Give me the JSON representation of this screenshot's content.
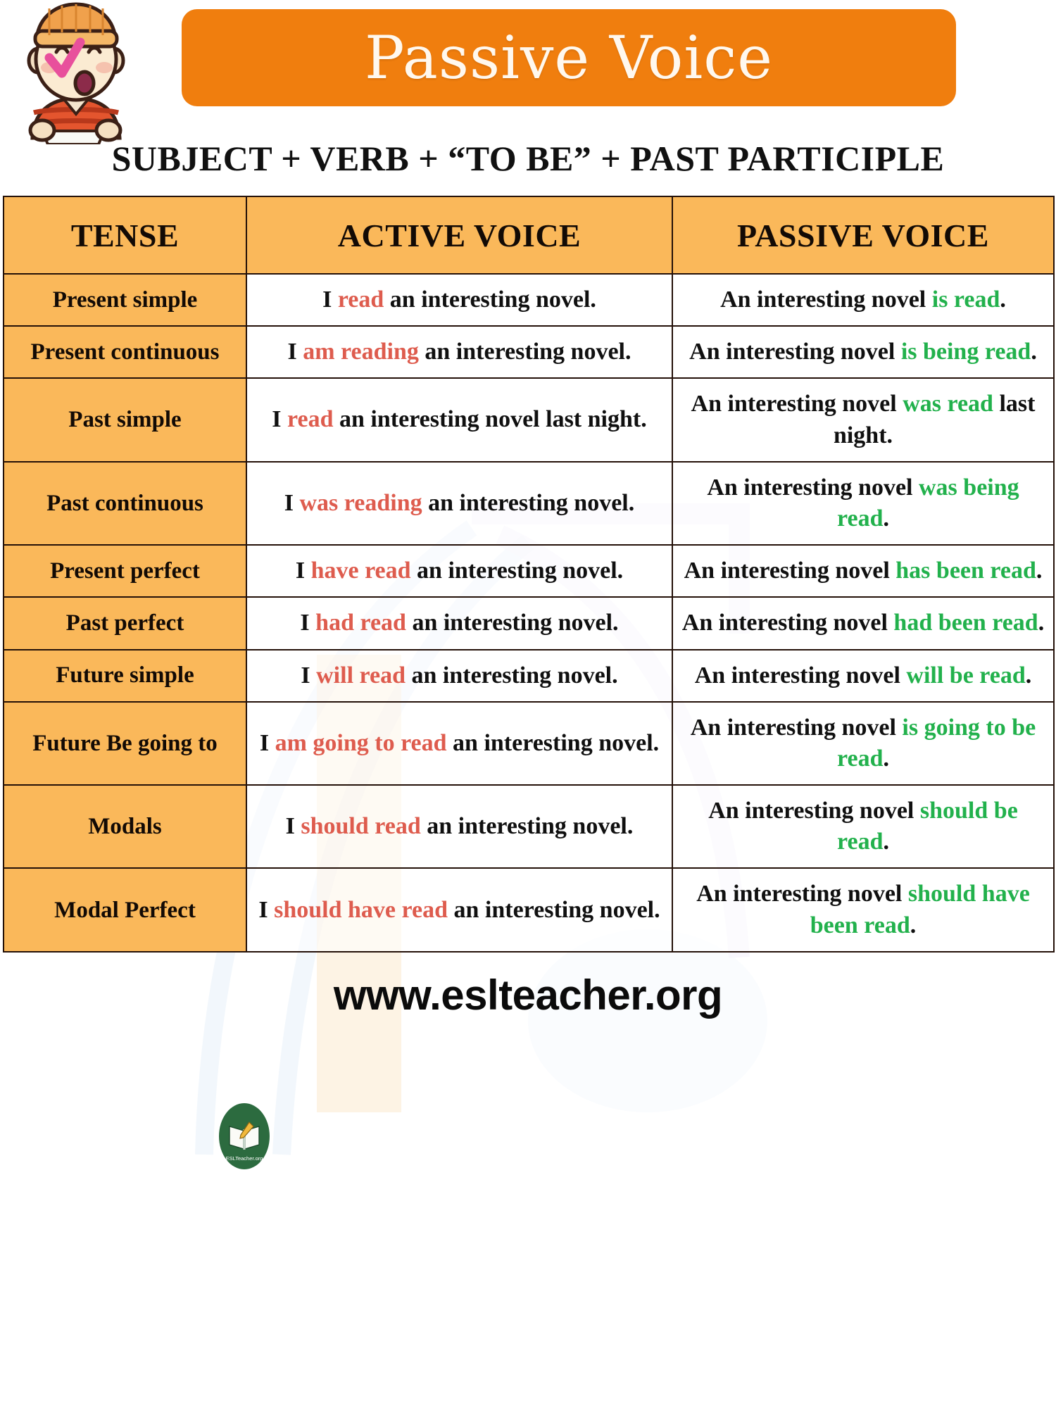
{
  "header": {
    "title": "Passive Voice",
    "mascot_icon": "cartoon-boy-with-beanie-icon",
    "formula": "SUBJECT + VERB + “TO BE” + PAST PARTICIPLE"
  },
  "colors": {
    "banner_orange": "#F07E0E",
    "header_cell_orange": "#FAB85A",
    "active_highlight_red": "#DE5C4E",
    "passive_highlight_green": "#22B14C",
    "border_dark": "#231008",
    "title_text_cream": "#FFF8EE"
  },
  "table": {
    "columns": [
      "TENSE",
      "ACTIVE VOICE",
      "PASSIVE VOICE"
    ],
    "rows": [
      {
        "tense": "Present simple",
        "active": {
          "full": "I read an interesting novel.",
          "pre": "I ",
          "highlight": "read",
          "post": " an interesting novel."
        },
        "passive": {
          "full": "An interesting novel is read.",
          "pre": "An interesting novel ",
          "highlight": "is read",
          "post": "."
        }
      },
      {
        "tense": "Present continuous",
        "active": {
          "full": "I am reading an interesting novel.",
          "pre": "I ",
          "highlight": "am reading",
          "post": " an interesting novel."
        },
        "passive": {
          "full": "An interesting novel is being read.",
          "pre": "An interesting novel ",
          "highlight": "is being read",
          "post": "."
        }
      },
      {
        "tense": "Past simple",
        "active": {
          "full": "I read an interesting novel last night.",
          "pre": "I ",
          "highlight": "read",
          "post": " an interesting novel last night."
        },
        "passive": {
          "full": "An interesting novel was read last night.",
          "pre": "An interesting novel ",
          "highlight": "was read",
          "post": " last night."
        }
      },
      {
        "tense": "Past continuous",
        "active": {
          "full": "I was reading an interesting novel.",
          "pre": "I ",
          "highlight": "was reading",
          "post": " an interesting novel."
        },
        "passive": {
          "full": "An interesting novel was being read.",
          "pre": "An interesting novel ",
          "highlight": "was being read",
          "post": "."
        }
      },
      {
        "tense": "Present perfect",
        "active": {
          "full": "I have read an interesting novel.",
          "pre": "I ",
          "highlight": "have read",
          "post": " an interesting novel."
        },
        "passive": {
          "full": "An interesting novel has been read.",
          "pre": "An interesting novel ",
          "highlight": "has been read",
          "post": "."
        }
      },
      {
        "tense": "Past perfect",
        "active": {
          "full": "I had read an interesting novel.",
          "pre": "I ",
          "highlight": "had read",
          "post": " an interesting novel."
        },
        "passive": {
          "full": "An interesting novel had been read.",
          "pre": "An interesting novel ",
          "highlight": "had been read",
          "post": "."
        }
      },
      {
        "tense": "Future simple",
        "active": {
          "full": "I will read an interesting novel.",
          "pre": "I ",
          "highlight": "will read",
          "post": " an interesting novel."
        },
        "passive": {
          "full": "An interesting novel will be read.",
          "pre": "An interesting novel ",
          "highlight": "will be read",
          "post": "."
        }
      },
      {
        "tense": "Future Be going to",
        "active": {
          "full": "I am going to read an interesting novel.",
          "pre": "I ",
          "highlight": "am going to read",
          "post": " an interesting novel."
        },
        "passive": {
          "full": "An interesting novel is going to be read.",
          "pre": "An interesting novel ",
          "highlight": "is going to be read",
          "post": "."
        }
      },
      {
        "tense": "Modals",
        "active": {
          "full": "I should read an interesting novel.",
          "pre": "I ",
          "highlight": "should read",
          "post": " an interesting novel."
        },
        "passive": {
          "full": "An interesting novel should be read.",
          "pre": "An interesting novel ",
          "highlight": "should be read",
          "post": "."
        }
      },
      {
        "tense": "Modal Perfect",
        "active": {
          "full": "I should have read an interesting novel.",
          "pre": "I ",
          "highlight": "should have read",
          "post": " an interesting novel."
        },
        "passive": {
          "full": "An interesting novel should have been read.",
          "pre": "An interesting novel ",
          "highlight": "should have been read",
          "post": "."
        }
      }
    ]
  },
  "logo": {
    "name": "eslteacher-book-logo",
    "caption": "ESLTeacher.org"
  },
  "footer": {
    "url": "www.eslteacher.org"
  }
}
